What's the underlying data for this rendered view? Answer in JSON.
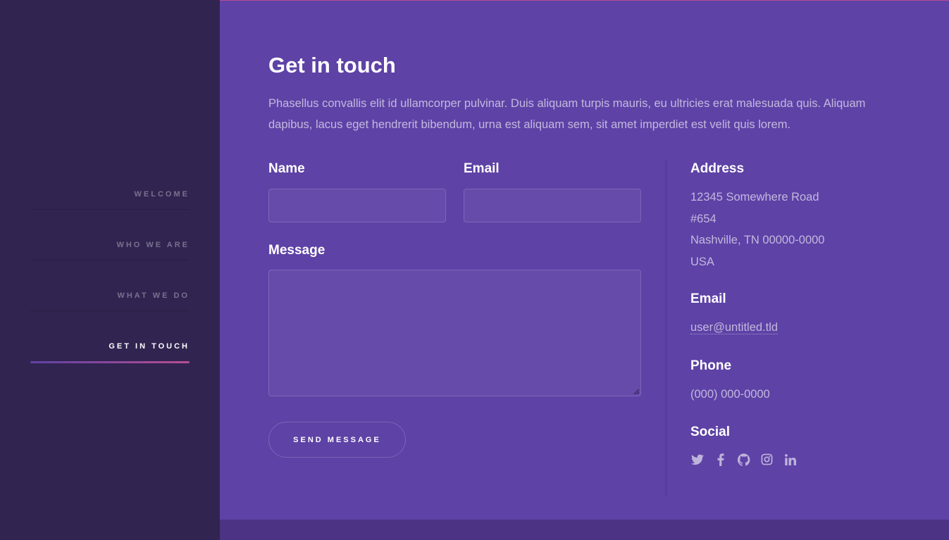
{
  "nav": {
    "items": [
      {
        "label": "Welcome"
      },
      {
        "label": "Who we are"
      },
      {
        "label": "What we do"
      },
      {
        "label": "Get in touch"
      }
    ],
    "active_index": 3,
    "active_gradient": [
      "#5e42a6",
      "#b74e91"
    ]
  },
  "main": {
    "title": "Get in touch",
    "intro": "Phasellus convallis elit id ullamcorper pulvinar. Duis aliquam turpis mauris, eu ultricies erat malesuada quis. Aliquam dapibus, lacus eget hendrerit bibendum, urna est aliquam sem, sit amet imperdiet est velit quis lorem."
  },
  "form": {
    "name_label": "Name",
    "name_value": "",
    "email_label": "Email",
    "email_value": "",
    "message_label": "Message",
    "message_value": "",
    "send_label": "Send Message"
  },
  "info": {
    "address_heading": "Address",
    "address_lines": [
      "12345 Somewhere Road",
      "#654",
      "Nashville, TN 00000-0000",
      "USA"
    ],
    "email_heading": "Email",
    "email_value": "user@untitled.tld",
    "phone_heading": "Phone",
    "phone_value": "(000) 000-0000",
    "social_heading": "Social",
    "social_icons": [
      "twitter-icon",
      "facebook-icon",
      "github-icon",
      "instagram-icon",
      "linkedin-icon"
    ]
  },
  "colors": {
    "sidebar_bg": "#312450",
    "main_bg": "#5e42a6",
    "footer_bg": "#4c3384",
    "accent": "#b74e91"
  }
}
